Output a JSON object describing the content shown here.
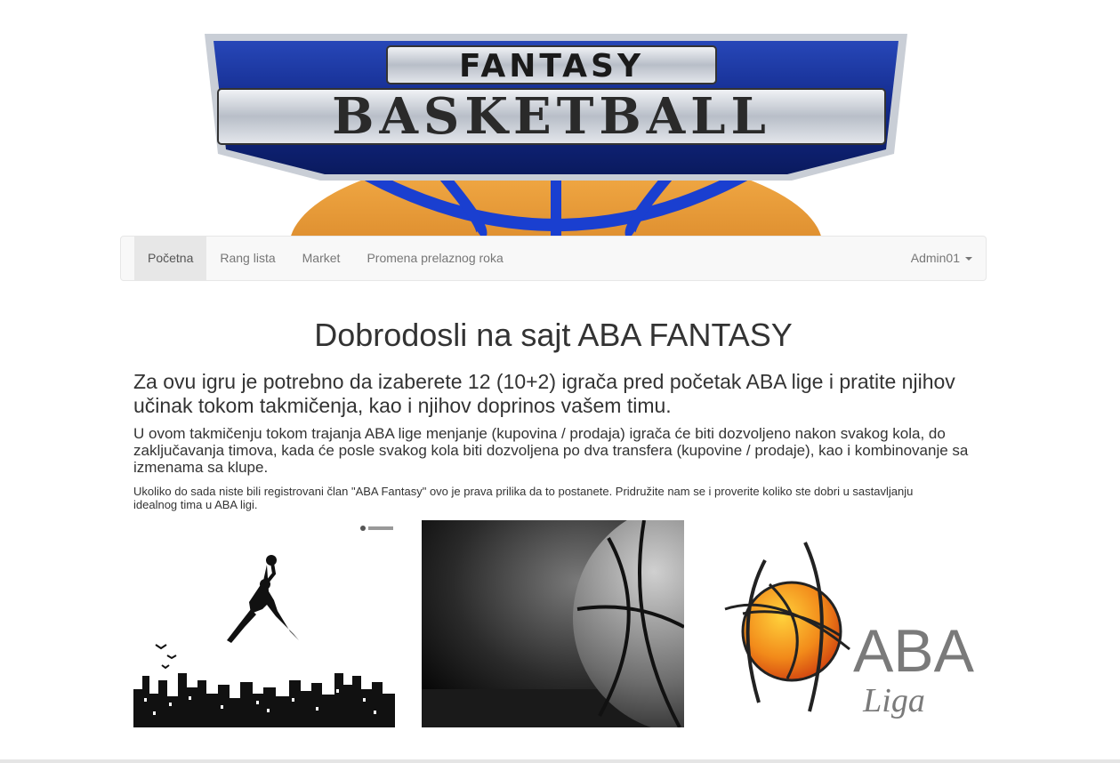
{
  "banner": {
    "line1": "FANTASY",
    "line2": "BASKETBALL"
  },
  "navbar": {
    "items": [
      {
        "label": "Početna"
      },
      {
        "label": "Rang lista"
      },
      {
        "label": "Market"
      },
      {
        "label": "Promena prelaznog roka"
      }
    ],
    "user": "Admin01"
  },
  "main": {
    "title": "Dobrodosli na sajt ABA FANTASY",
    "lead": "Za ovu igru je potrebno da izaberete 12 (10+2) igrača pred početak ABA lige i pratite njihov učinak tokom takmičenja, kao i njihov doprinos vašem timu.",
    "paragraph": "U ovom takmičenju tokom trajanja ABA lige menjanje (kupovina / prodaja) igrača će biti dozvoljeno nakon svakog kola, do zaključavanja timova, kada će posle svakog kola biti dozvoljena po dva transfera (kupovine / prodaje), kao i kombinovanje sa izmenama sa klupe.",
    "small": "Ukoliko do sada niste bili registrovani član \"ABA Fantasy\" ovo je prava prilika da to postanete. Pridružite nam se i proverite koliko ste dobri u sastavljanju idealnog tima u ABA ligi."
  },
  "images": {
    "aba_logo_text": "ABA",
    "aba_logo_sub": "Liga"
  },
  "colors": {
    "banner_blue": "#1c3a9e",
    "banner_silver": "#d9dde3",
    "ball_orange": "#f08c1e",
    "nav_bg": "#f8f8f8",
    "nav_active": "#e7e7e7"
  }
}
